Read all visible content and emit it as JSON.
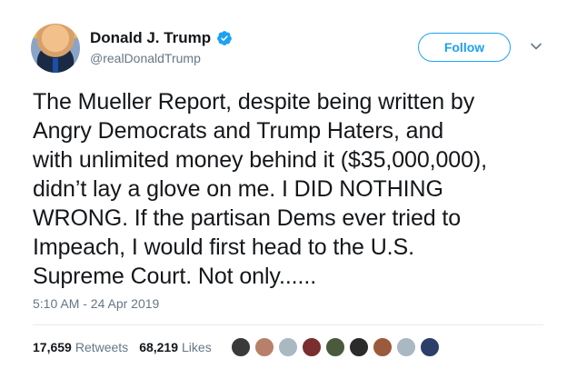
{
  "author": {
    "display_name": "Donald J. Trump",
    "handle": "@realDonaldTrump",
    "verified": true,
    "verified_icon": "verified-badge-icon"
  },
  "follow_button": {
    "label": "Follow"
  },
  "menu": {
    "icon": "chevron-down-icon"
  },
  "tweet": {
    "text": "The Mueller Report, despite being written by\nAngry Democrats and Trump Haters, and\nwith unlimited money behind it ($35,000,000),\ndidn’t lay a glove on me. I DID NOTHING\nWRONG. If the partisan Dems ever tried to\nImpeach, I would first head to the U.S.\nSupreme Court. Not only......",
    "timestamp": "5:10 AM - 24 Apr 2019"
  },
  "stats": {
    "retweets_count": "17,659",
    "retweets_label": "Retweets",
    "likes_count": "68,219",
    "likes_label": "Likes"
  },
  "likers": [
    {
      "name": "liker-avatar-1",
      "color": "#3a3a3a"
    },
    {
      "name": "liker-avatar-2",
      "color": "#b8806a"
    },
    {
      "name": "liker-avatar-3",
      "color": "#aab8c2"
    },
    {
      "name": "liker-avatar-4",
      "color": "#7a2e2e"
    },
    {
      "name": "liker-avatar-5",
      "color": "#4b5a3c"
    },
    {
      "name": "liker-avatar-6",
      "color": "#2b2b2b"
    },
    {
      "name": "liker-avatar-7",
      "color": "#9c5a3c"
    },
    {
      "name": "liker-avatar-8",
      "color": "#aab8c2"
    },
    {
      "name": "liker-avatar-9",
      "color": "#2c3f6b"
    }
  ],
  "colors": {
    "accent": "#1da1f2",
    "text_primary": "#14171a",
    "text_secondary": "#657786",
    "divider": "#e6ecf0"
  }
}
